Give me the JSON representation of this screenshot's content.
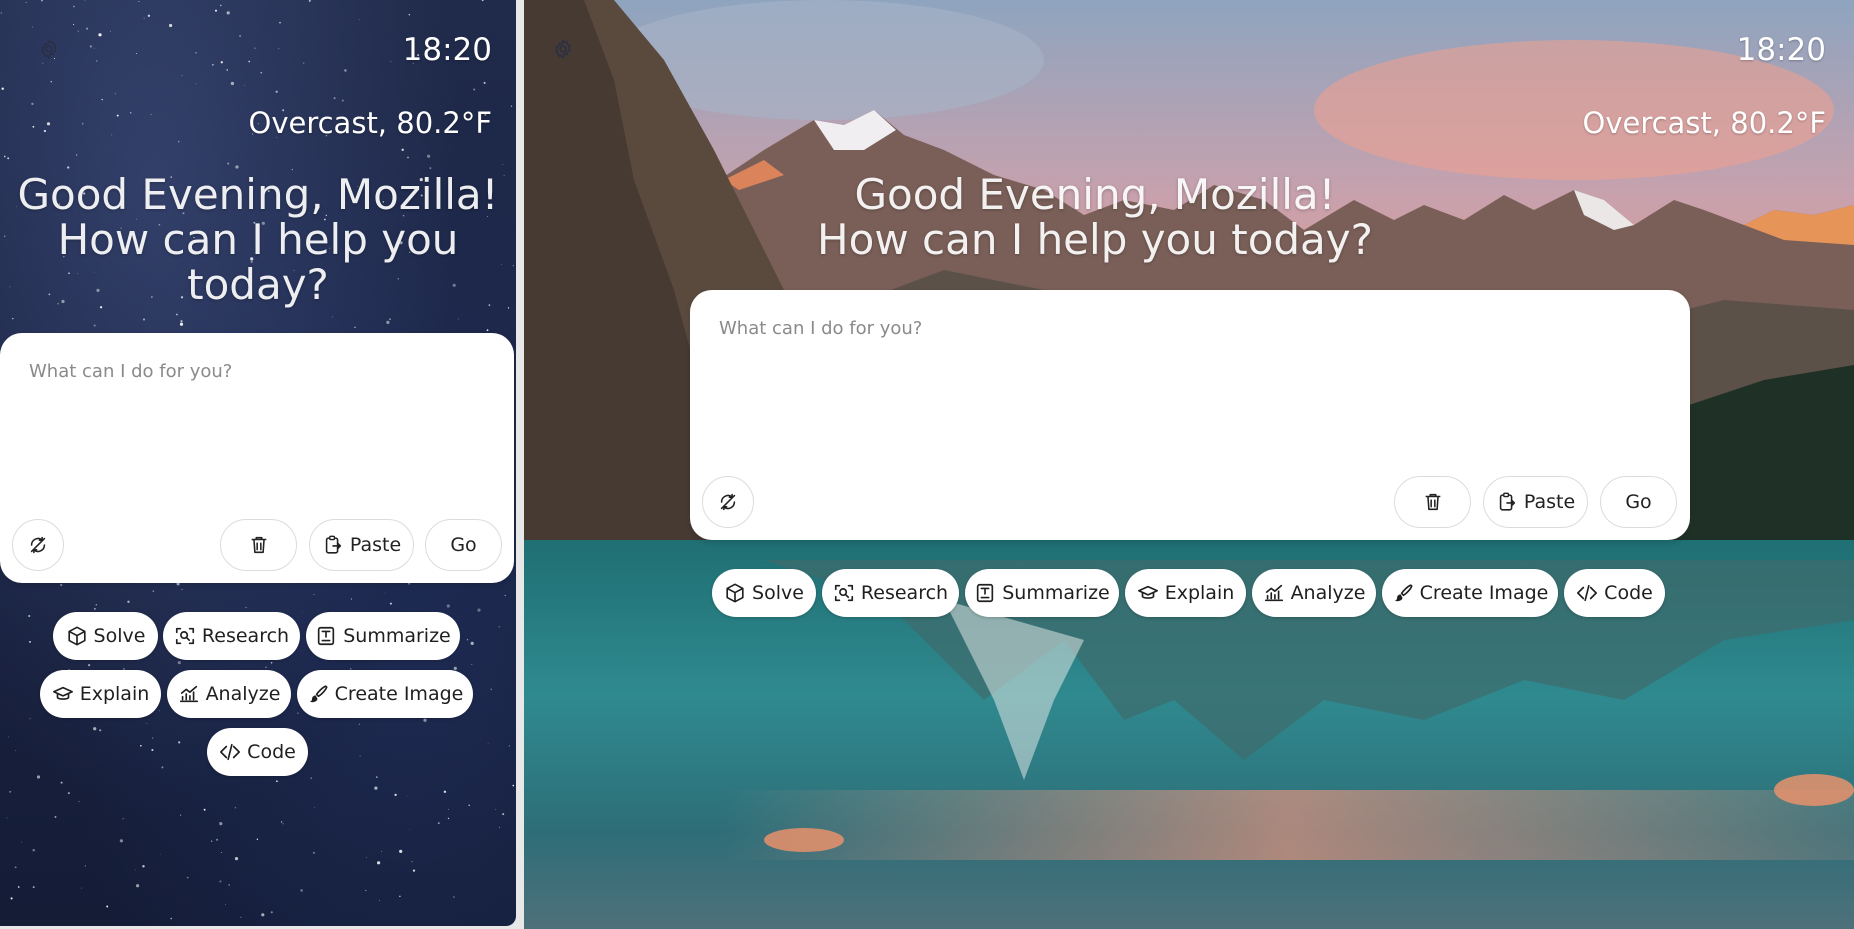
{
  "left_panel": {
    "time": "18:20",
    "weather": "Overcast, 80.2°F",
    "greeting_line1": "Good Evening, Mozilla!",
    "greeting_line2": "How can I help you",
    "greeting_line3": "today?",
    "prompt_placeholder": "What can I do for you?",
    "paste_label": "Paste",
    "go_label": "Go",
    "chips": {
      "solve": "Solve",
      "research": "Research",
      "summarize": "Summarize",
      "explain": "Explain",
      "analyze": "Analyze",
      "create_image": "Create Image",
      "code": "Code"
    }
  },
  "right_panel": {
    "time": "18:20",
    "weather": "Overcast, 80.2°F",
    "greeting_line1": "Good Evening, Mozilla!",
    "greeting_line2": "How can I help you today?",
    "prompt_placeholder": "What can I do for you?",
    "paste_label": "Paste",
    "go_label": "Go",
    "chips": {
      "solve": "Solve",
      "research": "Research",
      "summarize": "Summarize",
      "explain": "Explain",
      "analyze": "Analyze",
      "create_image": "Create Image",
      "code": "Code"
    }
  },
  "icons": {
    "settings": "gear-icon",
    "model_toggle": "no-sync-icon",
    "clear": "trash-icon",
    "paste": "clipboard-icon",
    "solve": "cube-icon",
    "research": "scan-search-icon",
    "summarize": "summary-icon",
    "explain": "graduation-cap-icon",
    "analyze": "chart-icon",
    "create_image": "brush-icon",
    "code": "code-icon"
  },
  "colors": {
    "card_bg": "#ffffff",
    "text_white": "#ffffff",
    "placeholder": "#8a8a8a"
  }
}
